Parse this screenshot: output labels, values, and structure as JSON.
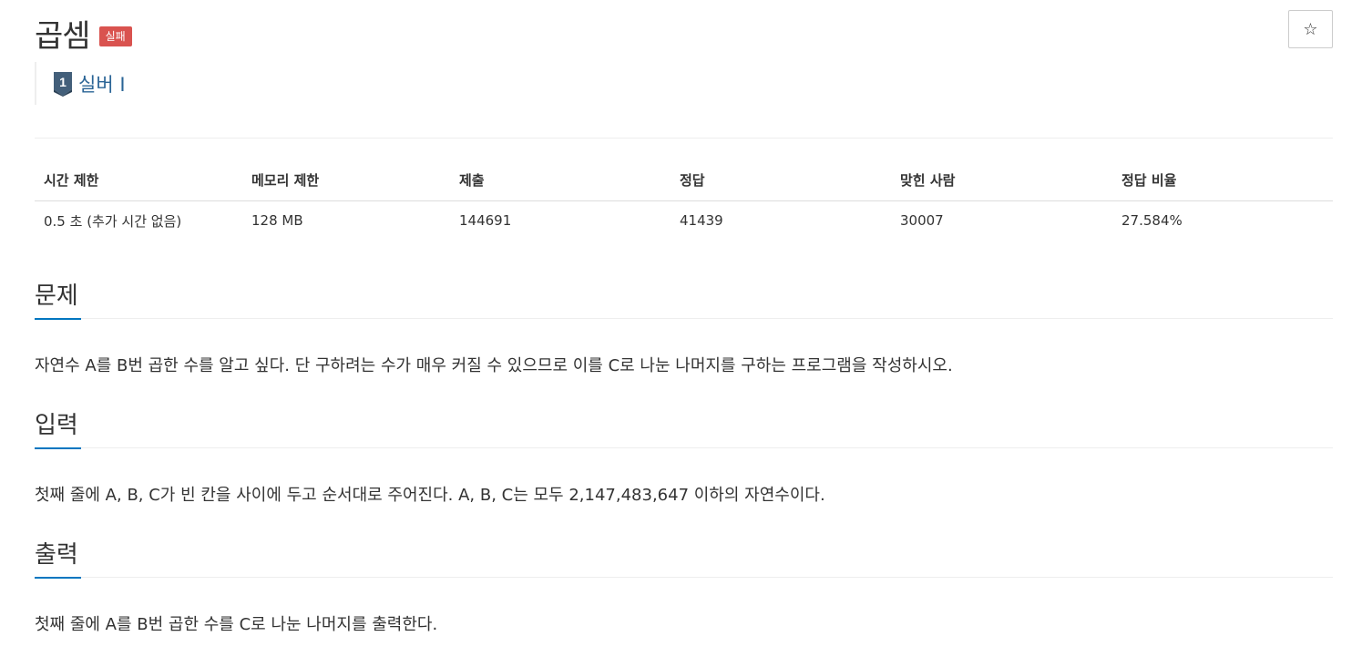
{
  "problem": {
    "title": "곱셈",
    "status_badge": "실패",
    "tier": "실버 I",
    "tier_level": "1",
    "favorite_icon": "☆"
  },
  "info_table": {
    "headers": [
      "시간 제한",
      "메모리 제한",
      "제출",
      "정답",
      "맞힌 사람",
      "정답 비율"
    ],
    "values": [
      "0.5 초 (추가 시간 없음)",
      "128 MB",
      "144691",
      "41439",
      "30007",
      "27.584%"
    ]
  },
  "sections": [
    {
      "title": "문제",
      "text": "자연수 A를 B번 곱한 수를 알고 싶다. 단 구하려는 수가 매우 커질 수 있으므로 이를 C로 나눈 나머지를 구하는 프로그램을 작성하시오."
    },
    {
      "title": "입력",
      "text": "첫째 줄에 A, B, C가 빈 칸을 사이에 두고 순서대로 주어진다. A, B, C는 모두 2,147,483,647 이하의 자연수이다."
    },
    {
      "title": "출력",
      "text": "첫째 줄에 A를 B번 곱한 수를 C로 나눈 나머지를 출력한다."
    }
  ],
  "colors": {
    "badge_fail": "#d9534f",
    "tier_text": "#2a6496",
    "tier_icon": "#435f7a",
    "section_accent": "#0076c0"
  }
}
